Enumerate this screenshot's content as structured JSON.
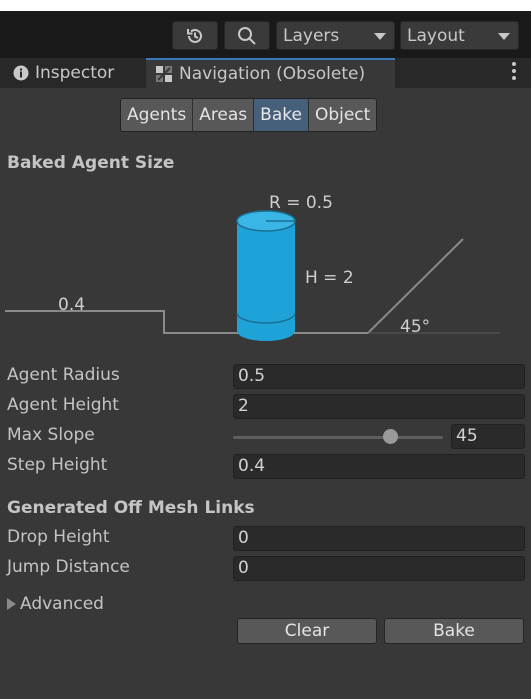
{
  "toolbar": {
    "history_icon": "history-icon",
    "search_icon": "search-icon",
    "layers_label": "Layers",
    "layout_label": "Layout"
  },
  "tabs": [
    {
      "label": "Inspector",
      "icon": "info-icon",
      "active": false
    },
    {
      "label": "Navigation (Obsolete)",
      "icon": "navigation-icon",
      "active": true
    }
  ],
  "segments": [
    {
      "label": "Agents",
      "selected": false
    },
    {
      "label": "Areas",
      "selected": false
    },
    {
      "label": "Bake",
      "selected": true
    },
    {
      "label": "Object",
      "selected": false
    }
  ],
  "baked_agent_size": {
    "heading": "Baked Agent Size",
    "radius_label": "R = 0.5",
    "height_label": "H = 2",
    "step_label": "0.4",
    "slope_label": "45°"
  },
  "fields": {
    "agent_radius": {
      "label": "Agent Radius",
      "value": "0.5"
    },
    "agent_height": {
      "label": "Agent Height",
      "value": "2"
    },
    "max_slope": {
      "label": "Max Slope",
      "value": "45",
      "slider_fraction": 0.75
    },
    "step_height": {
      "label": "Step Height",
      "value": "0.4"
    }
  },
  "offmesh": {
    "heading": "Generated Off Mesh Links",
    "drop_height": {
      "label": "Drop Height",
      "value": "0"
    },
    "jump_distance": {
      "label": "Jump Distance",
      "value": "0"
    }
  },
  "advanced_label": "Advanced",
  "buttons": {
    "clear": "Clear",
    "bake": "Bake"
  },
  "colors": {
    "accent": "#3a79bb",
    "agent_cylinder": "#1ea3d8",
    "selected_segment": "#46607c"
  }
}
